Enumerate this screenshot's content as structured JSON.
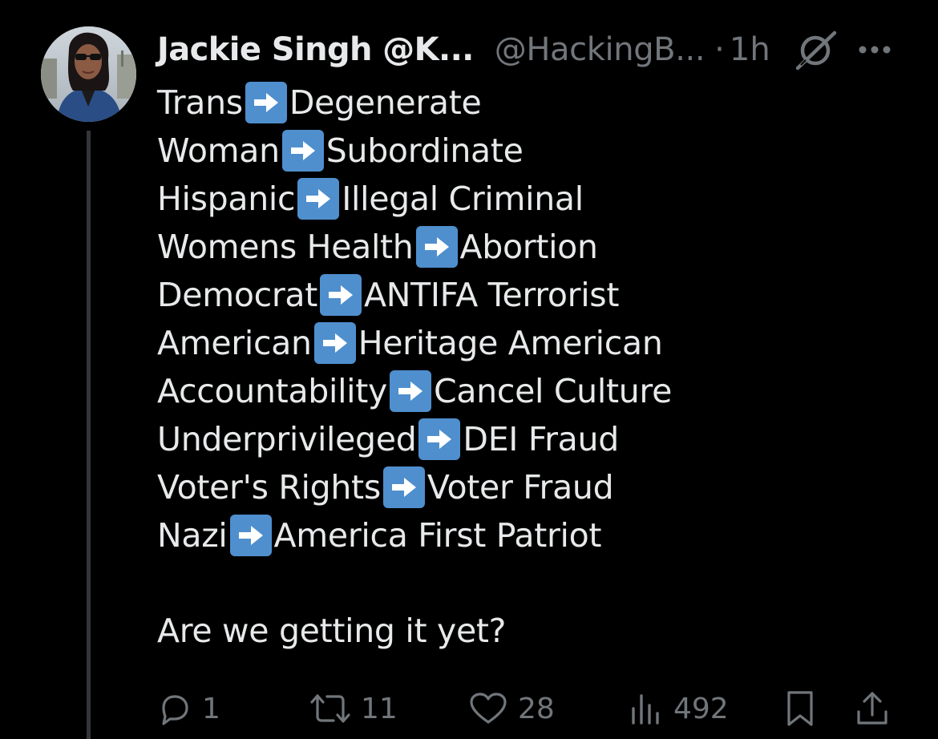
{
  "tweet": {
    "display_name": "Jackie Singh @K...",
    "handle": "@HackingB...",
    "separator": "·",
    "time": "1h",
    "lines": [
      {
        "left": "Trans",
        "right": "Degenerate"
      },
      {
        "left": "Woman",
        "right": "Subordinate"
      },
      {
        "left": "Hispanic",
        "right": "Illegal Criminal"
      },
      {
        "left": "Womens Health",
        "right": "Abortion"
      },
      {
        "left": "Democrat",
        "right": "ANTIFA Terrorist"
      },
      {
        "left": "American",
        "right": "Heritage American"
      },
      {
        "left": "Accountability",
        "right": "Cancel Culture"
      },
      {
        "left": "Underprivileged",
        "right": "DEI Fraud"
      },
      {
        "left": "Voter's Rights",
        "right": "Voter Fraud"
      },
      {
        "left": "Nazi",
        "right": "America First Patriot"
      }
    ],
    "closing": "Are we getting it yet?"
  },
  "actions": {
    "replies": "1",
    "reposts": "11",
    "likes": "28",
    "views": "492"
  },
  "icons": {
    "arrow": "right-arrow-emoji-icon",
    "grok": "grok-icon",
    "more": "more-dots-icon",
    "reply": "reply-icon",
    "repost": "repost-icon",
    "like": "heart-icon",
    "views": "views-icon",
    "bookmark": "bookmark-icon",
    "share": "share-icon"
  },
  "colors": {
    "background": "#000000",
    "text": "#e7e9ea",
    "muted": "#71767b",
    "arrow_bg": "#4f8fce",
    "thread_line": "#333639"
  }
}
